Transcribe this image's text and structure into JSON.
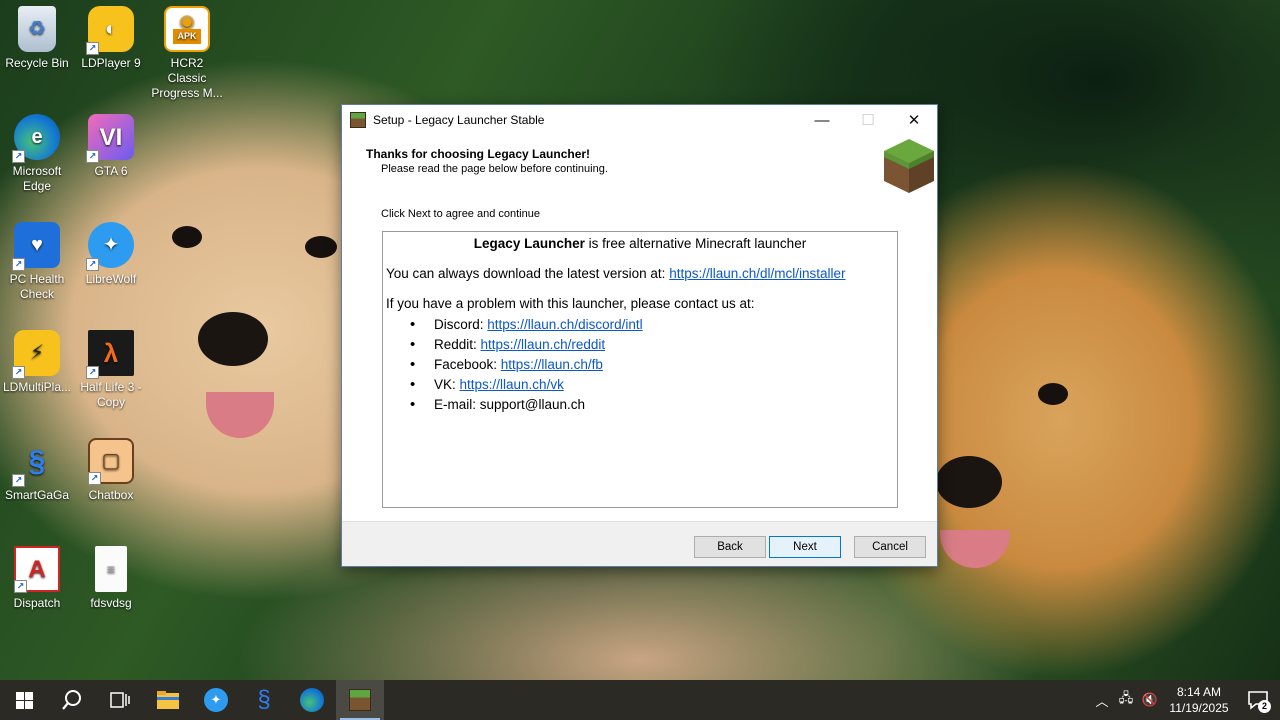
{
  "desktop": {
    "icons": [
      {
        "label": "Recycle Bin"
      },
      {
        "label": "LDPlayer 9"
      },
      {
        "label": "HCR2 Classic Progress M..."
      },
      {
        "label": "Microsoft Edge"
      },
      {
        "label": "GTA 6"
      },
      {
        "label": "PC Health Check"
      },
      {
        "label": "LibreWolf"
      },
      {
        "label": "LDMultiPla..."
      },
      {
        "label": "Half Life 3 - Copy"
      },
      {
        "label": "SmartGaGa"
      },
      {
        "label": "Chatbox"
      },
      {
        "label": "Dispatch"
      },
      {
        "label": "fdsvdsg"
      }
    ],
    "apk_badge": "APK"
  },
  "dialog": {
    "title": "Setup - Legacy Launcher Stable",
    "header_title": "Thanks for choosing Legacy Launcher!",
    "header_subtitle": "Please read the page below before continuing.",
    "instruction": "Click Next to agree and continue",
    "content": {
      "brand": "Legacy Launcher",
      "tagline": " is free alternative Minecraft launcher",
      "download_text": "You can always download the latest version at: ",
      "download_link": "https://llaun.ch/dl/mcl/installer",
      "contact_text": "If you have a problem with this launcher, please contact us at:",
      "contacts": [
        {
          "label": "Discord: ",
          "link": "https://llaun.ch/discord/intl"
        },
        {
          "label": "Reddit: ",
          "link": "https://llaun.ch/reddit"
        },
        {
          "label": "Facebook: ",
          "link": "https://llaun.ch/fb"
        },
        {
          "label": "VK: ",
          "link": "https://llaun.ch/vk"
        },
        {
          "label": "E-mail: ",
          "value": "support@llaun.ch"
        }
      ]
    },
    "buttons": {
      "back": "Back",
      "next": "Next",
      "cancel": "Cancel"
    }
  },
  "taskbar": {
    "time": "8:14 AM",
    "date": "11/19/2025",
    "notification_count": "2"
  }
}
